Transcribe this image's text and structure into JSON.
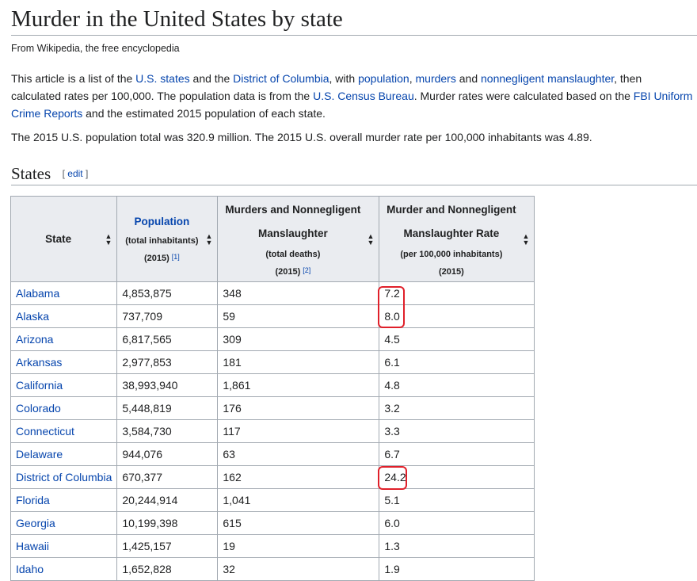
{
  "page": {
    "title": "Murder in the United States by state",
    "tagline": "From Wikipedia, the free encyclopedia",
    "intro": {
      "t1": "This article is a list of the ",
      "l1": "U.S. states",
      "t2": " and the ",
      "l2": "District of Columbia",
      "t3": ", with ",
      "l3": "population",
      "t4": ", ",
      "l4": "murders",
      "t5": " and ",
      "l5": "nonnegligent manslaughter",
      "t6": ", then calculated rates per 100,000. The population data is from the ",
      "l6": "U.S. Census Bureau",
      "t7": ". Murder rates were calculated based on the ",
      "l7": "FBI Uniform Crime Reports",
      "t8": " and the estimated 2015 population of each state."
    },
    "summary": "The 2015 U.S. population total was 320.9 million. The 2015 U.S. overall murder rate per 100,000 inhabitants was 4.89."
  },
  "section": {
    "heading": "States",
    "edit_open": "[ ",
    "edit_label": "edit",
    "edit_close": " ]"
  },
  "table": {
    "headers": {
      "state": "State",
      "population": {
        "main": "Population",
        "sub": "(total inhabitants)",
        "year": "(2015) ",
        "ref": "[1]"
      },
      "murders": {
        "line1": "Murders and Nonnegligent",
        "line2": "Manslaughter",
        "sub": "(total deaths)",
        "year": "(2015) ",
        "ref": "[2]"
      },
      "rate": {
        "line1": "Murder and Nonnegligent",
        "line2": "Manslaughter Rate",
        "sub": "(per 100,000 inhabitants)",
        "year": "(2015)"
      }
    },
    "sort_icon": "sort-arrows",
    "rows": [
      {
        "state": "Alabama",
        "population": "4,853,875",
        "murders": "348",
        "rate": "7.2"
      },
      {
        "state": "Alaska",
        "population": "737,709",
        "murders": "59",
        "rate": "8.0"
      },
      {
        "state": "Arizona",
        "population": "6,817,565",
        "murders": "309",
        "rate": "4.5"
      },
      {
        "state": "Arkansas",
        "population": "2,977,853",
        "murders": "181",
        "rate": "6.1"
      },
      {
        "state": "California",
        "population": "38,993,940",
        "murders": "1,861",
        "rate": "4.8"
      },
      {
        "state": "Colorado",
        "population": "5,448,819",
        "murders": "176",
        "rate": "3.2"
      },
      {
        "state": "Connecticut",
        "population": "3,584,730",
        "murders": "117",
        "rate": "3.3"
      },
      {
        "state": "Delaware",
        "population": "944,076",
        "murders": "63",
        "rate": "6.7"
      },
      {
        "state": "District of Columbia",
        "population": "670,377",
        "murders": "162",
        "rate": "24.2"
      },
      {
        "state": "Florida",
        "population": "20,244,914",
        "murders": "1,041",
        "rate": "5.1"
      },
      {
        "state": "Georgia",
        "population": "10,199,398",
        "murders": "615",
        "rate": "6.0"
      },
      {
        "state": "Hawaii",
        "population": "1,425,157",
        "murders": "19",
        "rate": "1.3"
      },
      {
        "state": "Idaho",
        "population": "1,652,828",
        "murders": "32",
        "rate": "1.9"
      }
    ]
  },
  "colors": {
    "link": "#0645ad",
    "highlight": "#e0202a",
    "header_bg": "#eaecf0",
    "border": "#a2a9b1"
  }
}
